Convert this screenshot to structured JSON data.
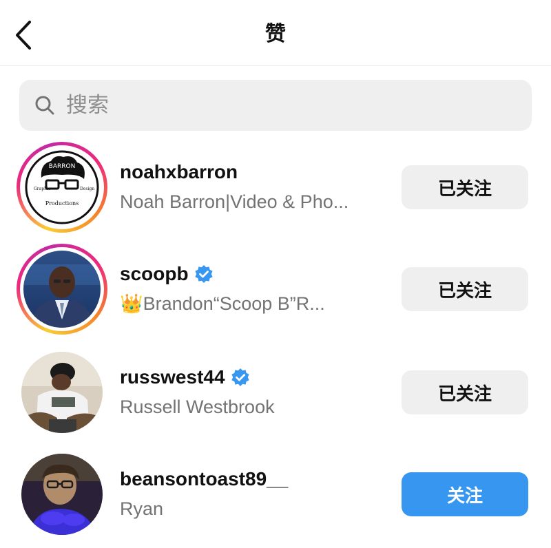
{
  "header": {
    "title": "赞",
    "back_icon": "chevron-left-icon"
  },
  "search": {
    "placeholder": "搜索",
    "icon": "search-icon"
  },
  "colors": {
    "follow_button": "#3797f0",
    "following_button_bg": "#efefef",
    "verified_badge": "#3897f0",
    "secondary_text": "#737373"
  },
  "users": [
    {
      "username": "noahxbarron",
      "full_name": "Noah Barron|Video & Pho...",
      "verified": false,
      "has_story_ring": true,
      "button_label": "已关注",
      "avatar_text": {
        "top": "BARRON",
        "left": "Graphic",
        "right": "Design",
        "bottom": "Productions"
      }
    },
    {
      "username": "scoopb",
      "full_name": "Brandon“Scoop B”R...",
      "full_name_emoji": "👑",
      "verified": true,
      "has_story_ring": true,
      "button_label": "已关注"
    },
    {
      "username": "russwest44",
      "full_name": "Russell Westbrook",
      "verified": true,
      "has_story_ring": false,
      "button_label": "已关注"
    },
    {
      "username": "beansontoast89__",
      "full_name": "Ryan",
      "verified": false,
      "has_story_ring": false,
      "button_label": "关注"
    }
  ]
}
